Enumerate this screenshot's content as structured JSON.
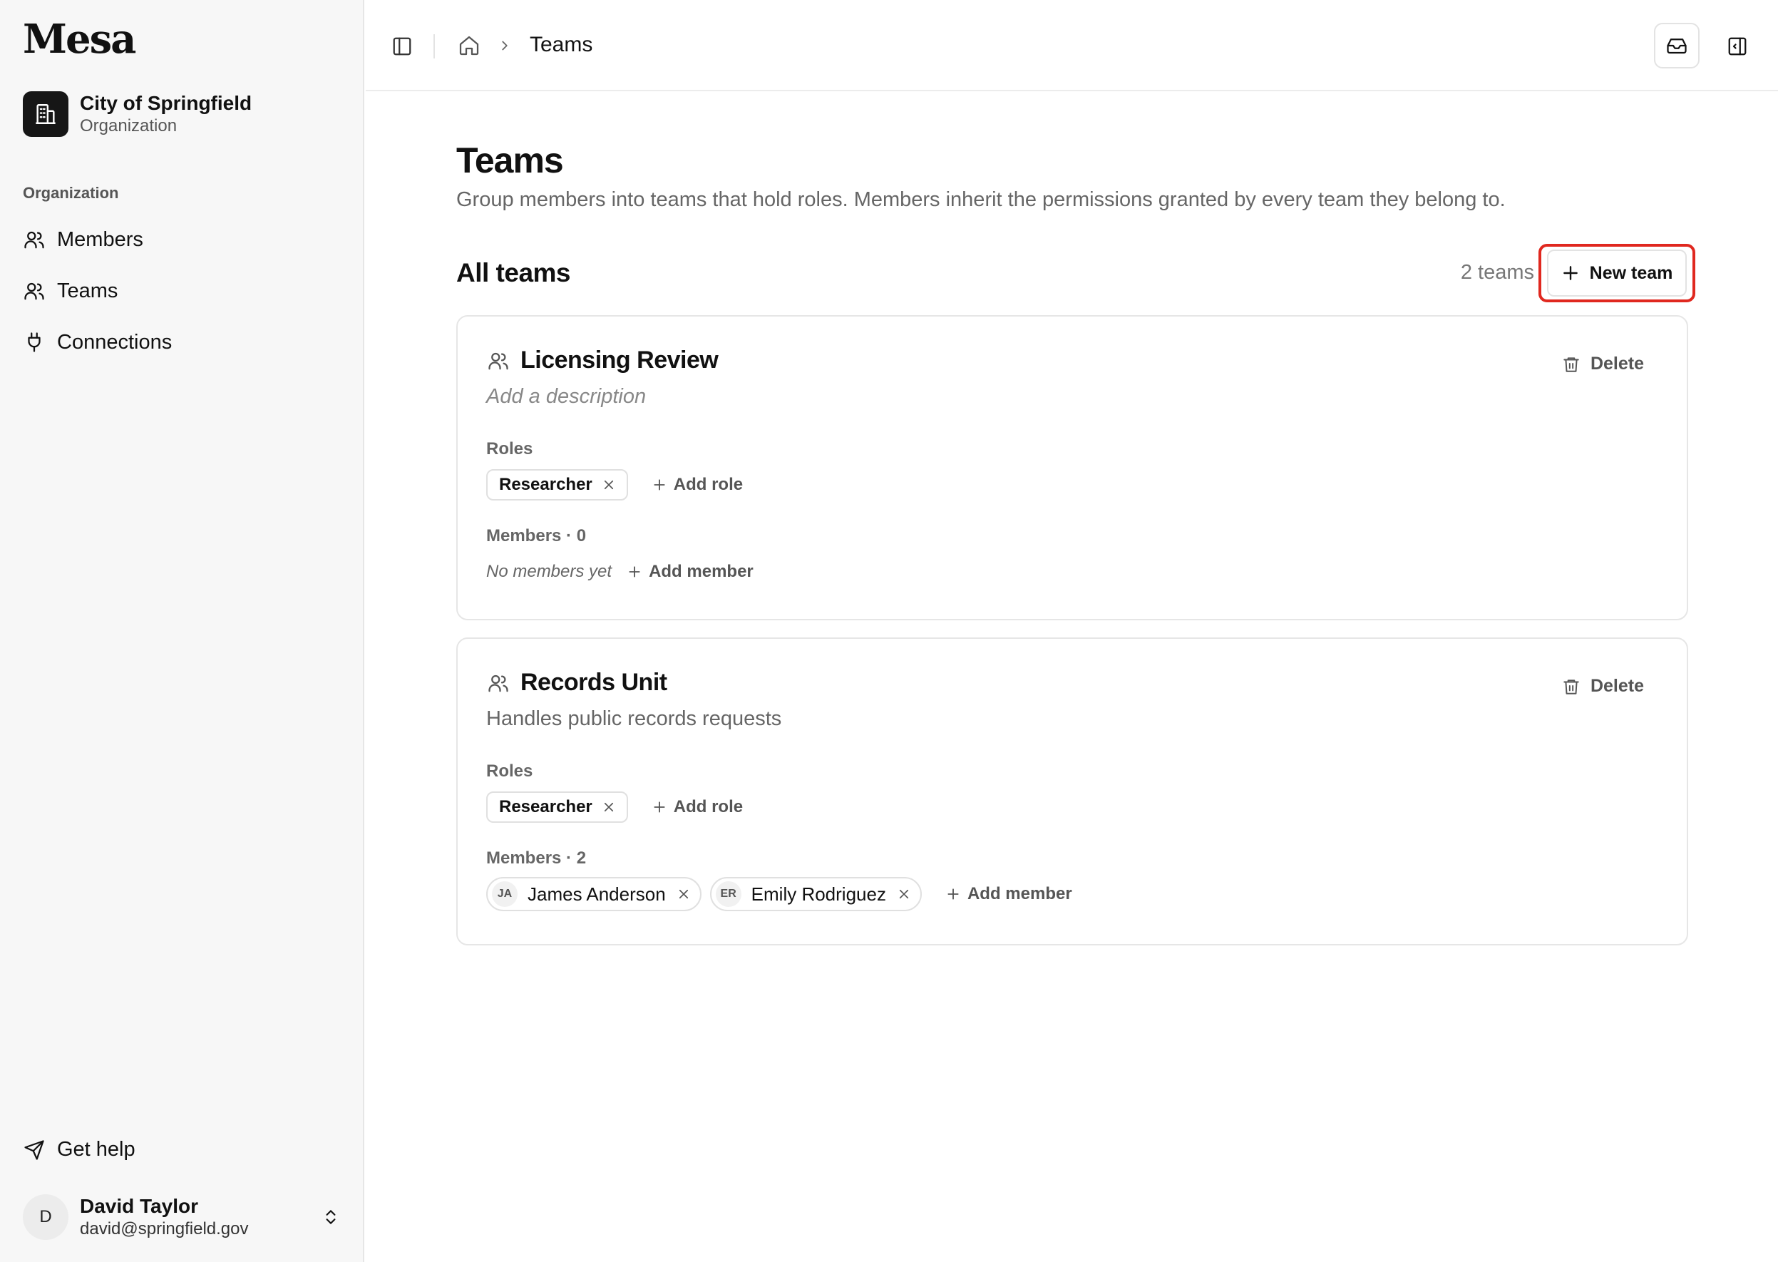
{
  "app": {
    "logo": "Mesa"
  },
  "org": {
    "name": "City of Springfield",
    "type": "Organization"
  },
  "nav": {
    "section_label": "Organization",
    "items": [
      {
        "label": "Members",
        "icon": "members-icon"
      },
      {
        "label": "Teams",
        "icon": "teams-icon"
      },
      {
        "label": "Connections",
        "icon": "plug-icon"
      }
    ]
  },
  "footer": {
    "help_label": "Get help",
    "user": {
      "initial": "D",
      "name": "David Taylor",
      "email": "david@springfield.gov"
    }
  },
  "topbar": {
    "breadcrumb_current": "Teams"
  },
  "page": {
    "title": "Teams",
    "description": "Group members into teams that hold roles. Members inherit the permissions granted by every team they belong to.",
    "section_title": "All teams",
    "team_count": "2 teams",
    "new_team_label": "New team"
  },
  "teams": [
    {
      "name": "Licensing Review",
      "description": "Add a description",
      "description_is_placeholder": true,
      "delete_label": "Delete",
      "roles_label": "Roles",
      "roles": [
        "Researcher"
      ],
      "add_role_label": "Add role",
      "members_label": "Members · 0",
      "empty_members": "No members yet",
      "members": [],
      "add_member_label": "Add member"
    },
    {
      "name": "Records Unit",
      "description": "Handles public records requests",
      "description_is_placeholder": false,
      "delete_label": "Delete",
      "roles_label": "Roles",
      "roles": [
        "Researcher"
      ],
      "add_role_label": "Add role",
      "members_label": "Members · 2",
      "members": [
        {
          "initials": "JA",
          "name": "James Anderson"
        },
        {
          "initials": "ER",
          "name": "Emily Rodriguez"
        }
      ],
      "add_member_label": "Add member"
    }
  ],
  "colors": {
    "highlight": "#e0281f",
    "sidebar_bg": "#f7f7f7",
    "org_avatar_bg": "#161616"
  }
}
